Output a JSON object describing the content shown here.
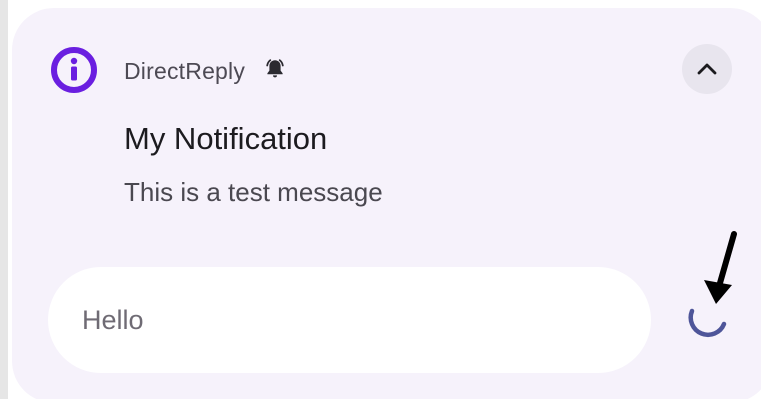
{
  "notification": {
    "app_name": "DirectReply",
    "title": "My Notification",
    "message": "This is a test message"
  },
  "reply": {
    "input_text": "Hello"
  },
  "colors": {
    "app_icon": "#6a1fe0",
    "card_bg": "#f6f2fb",
    "spinner": "#4e5599",
    "arrow": "#000000"
  },
  "icons": {
    "app": "info-icon",
    "alert": "bell-icon",
    "collapse": "chevron-up-icon",
    "sending": "loading-spinner-icon",
    "annotation": "arrow-annotation"
  }
}
